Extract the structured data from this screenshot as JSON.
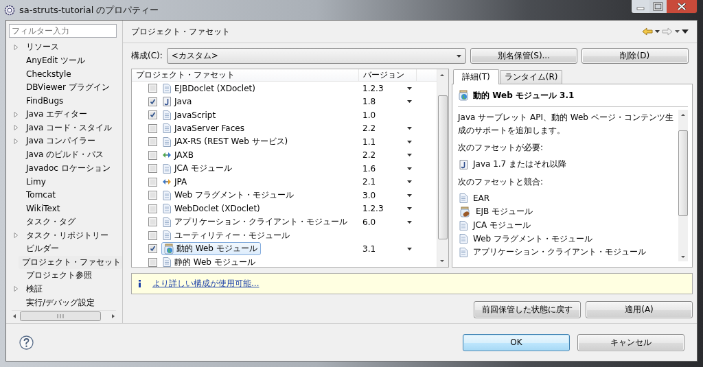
{
  "window": {
    "title": "sa-struts-tutorial のプロパティー"
  },
  "filter": {
    "placeholder": "フィルター入力"
  },
  "sidebar": {
    "items": [
      {
        "label": "リソース",
        "expandable": true,
        "selected": false
      },
      {
        "label": "AnyEdit ツール",
        "expandable": false,
        "selected": false
      },
      {
        "label": "Checkstyle",
        "expandable": false,
        "selected": false
      },
      {
        "label": "DBViewer プラグイン",
        "expandable": false,
        "selected": false
      },
      {
        "label": "FindBugs",
        "expandable": false,
        "selected": false
      },
      {
        "label": "Java エディター",
        "expandable": true,
        "selected": false
      },
      {
        "label": "Java コード・スタイル",
        "expandable": true,
        "selected": false
      },
      {
        "label": "Java コンパイラー",
        "expandable": true,
        "selected": false
      },
      {
        "label": "Java のビルド・パス",
        "expandable": false,
        "selected": false
      },
      {
        "label": "Javadoc ロケーション",
        "expandable": false,
        "selected": false
      },
      {
        "label": "Limy",
        "expandable": false,
        "selected": false
      },
      {
        "label": "Tomcat",
        "expandable": false,
        "selected": false
      },
      {
        "label": "WikiText",
        "expandable": false,
        "selected": false
      },
      {
        "label": "タスク・タグ",
        "expandable": false,
        "selected": false
      },
      {
        "label": "タスク・リポジトリー",
        "expandable": true,
        "selected": false
      },
      {
        "label": "ビルダー",
        "expandable": false,
        "selected": false
      },
      {
        "label": "プロジェクト・ファセット",
        "expandable": false,
        "selected": true
      },
      {
        "label": "プロジェクト参照",
        "expandable": false,
        "selected": false
      },
      {
        "label": "検証",
        "expandable": true,
        "selected": false
      },
      {
        "label": "実行/デバッグ設定",
        "expandable": false,
        "selected": false
      }
    ]
  },
  "page": {
    "title": "プロジェクト・ファセット"
  },
  "configuration": {
    "label": "構成(C):",
    "value": "<カスタム>",
    "buttons": [
      "別名保管(S)...",
      "削除(D)"
    ]
  },
  "facets": {
    "columns": [
      "プロジェクト・ファセット",
      "バージョン"
    ],
    "rows": [
      {
        "name": "EJBDoclet (XDoclet)",
        "version": "1.2.3",
        "version_menu": true,
        "checked": false,
        "selected": false,
        "kind": "doc"
      },
      {
        "name": "Java",
        "version": "1.8",
        "version_menu": true,
        "checked": true,
        "selected": false,
        "kind": "java"
      },
      {
        "name": "JavaScript",
        "version": "1.0",
        "version_menu": false,
        "checked": true,
        "selected": false,
        "kind": "doc"
      },
      {
        "name": "JavaServer Faces",
        "version": "2.2",
        "version_menu": true,
        "checked": false,
        "selected": false,
        "kind": "doc"
      },
      {
        "name": "JAX-RS (REST Web サービス)",
        "version": "1.1",
        "version_menu": true,
        "checked": false,
        "selected": false,
        "kind": "doc"
      },
      {
        "name": "JAXB",
        "version": "2.2",
        "version_menu": true,
        "checked": false,
        "selected": false,
        "kind": "jaxb"
      },
      {
        "name": "JCA モジュール",
        "version": "1.6",
        "version_menu": true,
        "checked": false,
        "selected": false,
        "kind": "doc"
      },
      {
        "name": "JPA",
        "version": "2.1",
        "version_menu": true,
        "checked": false,
        "selected": false,
        "kind": "jpa"
      },
      {
        "name": "Web フラグメント・モジュール",
        "version": "3.0",
        "version_menu": true,
        "checked": false,
        "selected": false,
        "kind": "doc"
      },
      {
        "name": "WebDoclet (XDoclet)",
        "version": "1.2.3",
        "version_menu": true,
        "checked": false,
        "selected": false,
        "kind": "doc"
      },
      {
        "name": "アプリケーション・クライアント・モジュール",
        "version": "6.0",
        "version_menu": true,
        "checked": false,
        "selected": false,
        "kind": "doc"
      },
      {
        "name": "ユーティリティー・モジュール",
        "version_menu": false,
        "checked": false,
        "selected": false,
        "kind": "doc"
      },
      {
        "name": "動的 Web モジュール",
        "version": "3.1",
        "version_menu": true,
        "checked": true,
        "selected": true,
        "kind": "web"
      },
      {
        "name": "静的 Web モジュール",
        "version_menu": false,
        "checked": false,
        "selected": false,
        "kind": "doc"
      }
    ]
  },
  "details": {
    "tabs": [
      {
        "label": "詳細(T)",
        "selected": true
      },
      {
        "label": "ランタイム(R)",
        "selected": false
      }
    ],
    "heading": "動的 Web モジュール 3.1",
    "description": "Java サーブレット API、動的 Web ページ・コンテンツ生成のサポートを追加します。",
    "requires_label": "次のファセットが必要:",
    "requires": [
      {
        "label": "Java 1.7 またはそれ以降",
        "kind": "java"
      }
    ],
    "conflicts_label": "次のファセットと競合:",
    "conflicts": [
      {
        "label": "EAR",
        "kind": "doc"
      },
      {
        "label": "EJB モジュール",
        "kind": "ejb"
      },
      {
        "label": "JCA モジュール",
        "kind": "doc"
      },
      {
        "label": "Web フラグメント・モジュール",
        "kind": "doc"
      },
      {
        "label": "アプリケーション・クライアント・モジュール",
        "kind": "doc"
      }
    ]
  },
  "info": {
    "link": "より詳しい構成が使用可能..."
  },
  "actions": [
    "前回保管した状態に戻す",
    "適用(A)"
  ],
  "footer": {
    "buttons": [
      {
        "label": "OK",
        "default": true
      },
      {
        "label": "キャンセル",
        "default": false
      }
    ]
  }
}
